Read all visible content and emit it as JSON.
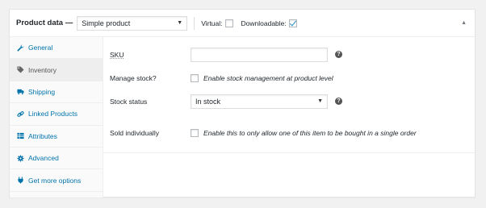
{
  "header": {
    "title": "Product data —",
    "product_type": "Simple product",
    "virtual_label": "Virtual:",
    "downloadable_label": "Downloadable:",
    "virtual_checked": false,
    "downloadable_checked": true
  },
  "tabs": [
    {
      "label": "General",
      "icon": "wrench-icon",
      "active": false
    },
    {
      "label": "Inventory",
      "icon": "tag-icon",
      "active": true
    },
    {
      "label": "Shipping",
      "icon": "truck-icon",
      "active": false
    },
    {
      "label": "Linked Products",
      "icon": "link-icon",
      "active": false
    },
    {
      "label": "Attributes",
      "icon": "table-icon",
      "active": false
    },
    {
      "label": "Advanced",
      "icon": "gear-icon",
      "active": false
    },
    {
      "label": "Get more options",
      "icon": "plugin-icon",
      "active": false
    }
  ],
  "inventory": {
    "sku_label": "SKU",
    "sku_value": "",
    "manage_stock_label": "Manage stock?",
    "manage_stock_desc": "Enable stock management at product level",
    "stock_status_label": "Stock status",
    "stock_status_value": "In stock",
    "sold_individually_label": "Sold individually",
    "sold_individually_desc": "Enable this to only allow one of this item to be bought in a single order"
  },
  "help_glyph": "?",
  "colors": {
    "link": "#0073aa",
    "checkmark": "#1e8cbe"
  }
}
